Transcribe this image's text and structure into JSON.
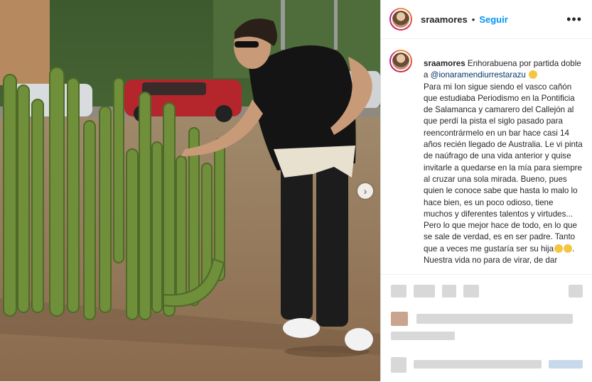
{
  "post": {
    "username": "sraamores",
    "separator": "•",
    "follow_label": "Seguir",
    "more_label": "•••",
    "caption": {
      "username": "sraamores",
      "line1": " Enhorabuena por partida doble a ",
      "mention": "@ionaramendiurrestarazu",
      "rest": "Para mi Ion sigue siendo el vasco cañón que estudiaba Periodismo en la Pontificia de Salamanca y camarero del Callejón al que perdí la pista el siglo pasado para reencontrármelo en un bar hace casi 14 años recién llegado de Australia. Le vi pinta de naúfrago de una vida anterior y quise invitarle a quedarse en la mía para siempre al cruzar una sola mirada. Bueno, pues quien le conoce sabe que hasta lo malo lo hace bien, es un poco odioso, tiene muchos y diferentes talentos y virtudes... Pero lo que mejor hace de todo, en lo que se sale de verdad, es en ser padre. Tanto que a veces me gustaría ser su hija",
      "tail": "Nuestra vida no para de virar, de dar"
    },
    "carousel_next": "›"
  },
  "colors": {
    "follow": "#0095f6",
    "mention": "#00376b",
    "text": "#262626"
  },
  "icons": [
    "more-options-icon",
    "chevron-right-icon",
    "emoji-icon"
  ]
}
